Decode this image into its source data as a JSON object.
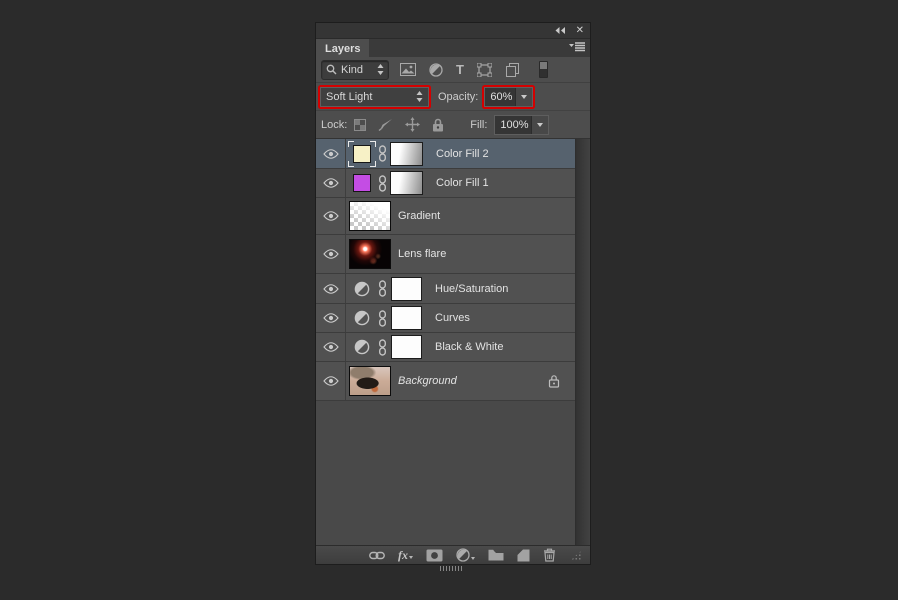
{
  "window": {
    "close_glyph": "✕"
  },
  "panel": {
    "tab": "Layers"
  },
  "filter_bar": {
    "kind_label": "Kind",
    "type_filter_glyph": "T"
  },
  "blend_bar": {
    "blend_mode": "Soft Light",
    "opacity_label": "Opacity:",
    "opacity_value": "60%"
  },
  "lock_bar": {
    "lock_label": "Lock:",
    "fill_label": "Fill:",
    "fill_value": "100%"
  },
  "layers": [
    {
      "name": "Color Fill 2",
      "type": "fill",
      "selected": true,
      "swatch": "#f7f1c6"
    },
    {
      "name": "Color Fill 1",
      "type": "fill",
      "selected": false,
      "swatch": "#c44de4"
    },
    {
      "name": "Gradient",
      "type": "pixel"
    },
    {
      "name": "Lens flare",
      "type": "pixel"
    },
    {
      "name": "Hue/Saturation",
      "type": "adjustment"
    },
    {
      "name": "Curves",
      "type": "adjustment"
    },
    {
      "name": "Black & White",
      "type": "adjustment"
    },
    {
      "name": "Background",
      "type": "background",
      "locked": true
    }
  ],
  "toolbar": {
    "fx_label": "fx"
  },
  "colors": {
    "selected_row": "#56626e",
    "highlight_red": "#d40000",
    "panel_row": "#515151",
    "swatch_color_fill_2": "#f7f1c6",
    "swatch_color_fill_1": "#c44de4"
  }
}
